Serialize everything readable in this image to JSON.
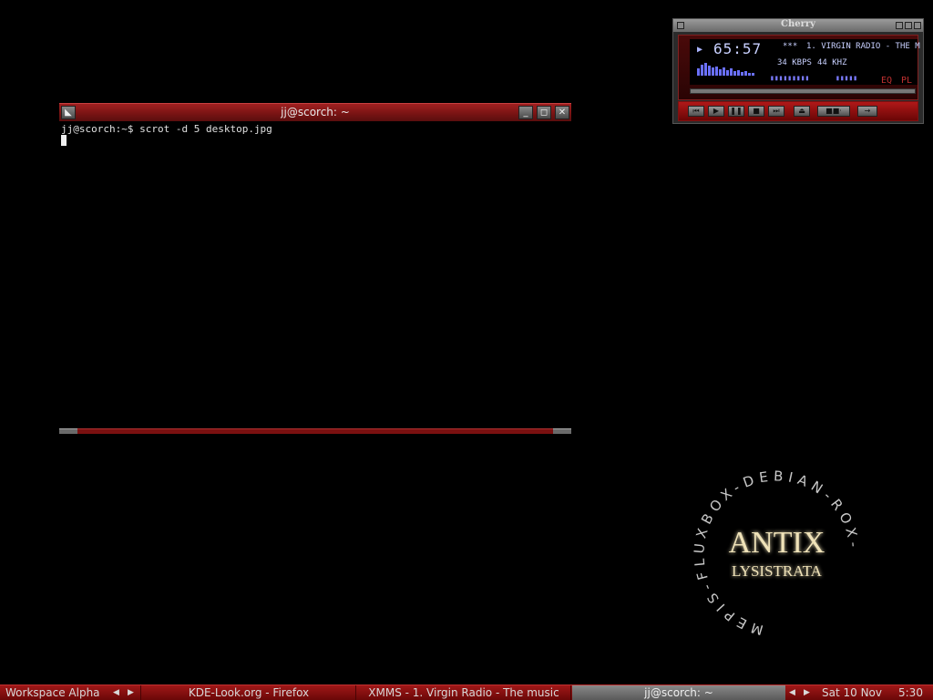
{
  "terminal": {
    "title": "jj@scorch: ~",
    "prompt": "jj@scorch:~$",
    "command": "scrot -d 5 desktop.jpg"
  },
  "xmms": {
    "title": "Cherry",
    "time": "65:57",
    "marquee": "1. VIRGIN RADIO - THE M",
    "kbps": "34 KBPS",
    "khz": "44 KHZ",
    "eq_label": "EQ",
    "pl_label": "PL",
    "stars": "***",
    "play_glyph": "▶"
  },
  "logo": {
    "ring_text": "MEPIS-FLUXBOX-DEBIAN-ROX-",
    "title": "ANTIX",
    "subtitle": "LYSISTRATA"
  },
  "taskbar": {
    "workspace": "Workspace Alpha",
    "tasks": [
      "KDE-Look.org - Firefox",
      "XMMS - 1. Virgin Radio - The music",
      "jj@scorch: ~"
    ],
    "date": "Sat 10 Nov",
    "time": "5:30"
  },
  "colors": {
    "accent": "#8a1010",
    "terminal_bg": "#000000"
  }
}
